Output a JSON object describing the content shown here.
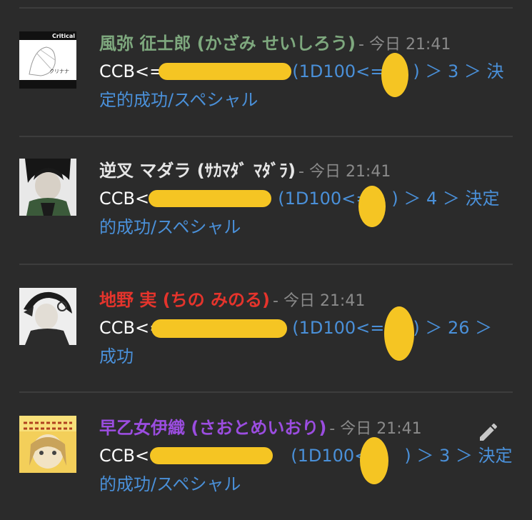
{
  "messages": [
    {
      "author": "風弥 征士郎 (かざみ せいしろう)",
      "author_color": "#7ea87e",
      "time": "- 今日 21:41",
      "command": "CCB<=",
      "result": "(1D100<=",
      "result_tail": ") ＞ 3 ＞ 決定的成功/スペシャル",
      "avatar_text": "Critical",
      "avatar_caption": "クリナナ"
    },
    {
      "author": "逆叉 マダラ (ｻｶﾏﾀﾞ ﾏﾀﾞﾗ)",
      "author_color": "#e6e6e6",
      "time": "- 今日 21:41",
      "command": "CCB<=",
      "result": "(1D100<=",
      "result_tail": ") ＞ 4 ＞ 決定的成功/スペシャル"
    },
    {
      "author": "地野 実 (ちの みのる)",
      "author_color": "#e5342c",
      "time": "- 今日 21:41",
      "command": "CCB<=",
      "result": "(1D100<=",
      "result_tail": ") ＞ 26 ＞ 成功"
    },
    {
      "author": "早乙女伊織 (さおとめいおり)",
      "author_color": "#9b4de0",
      "time": "- 今日 21:41",
      "command": "CCB<=",
      "result": "(1D100<=",
      "result_tail": ") ＞ 3 ＞ 決定的成功/スペシャル"
    }
  ],
  "icons": {
    "edit": "pencil-icon"
  },
  "colors": {
    "background": "#2b2b2b",
    "result": "#4a90d9",
    "redaction": "#f5c523",
    "timestamp": "#8a8a8a"
  }
}
